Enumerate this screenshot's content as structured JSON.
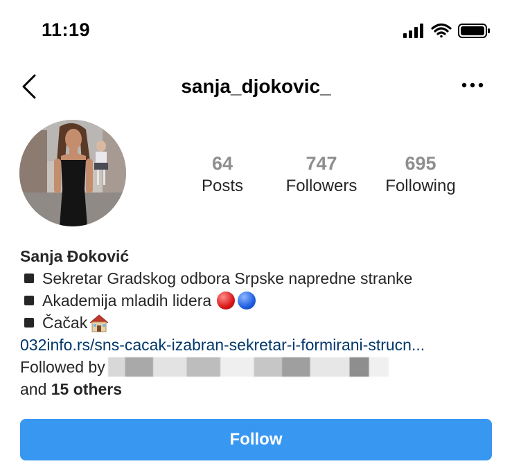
{
  "status_bar": {
    "time": "11:19",
    "icons": [
      "signal-bars-icon",
      "wifi-icon",
      "battery-icon"
    ]
  },
  "nav": {
    "title": "sanja_djokovic_",
    "back_icon": "chevron-left-icon",
    "more_icon": "more-horizontal-icon"
  },
  "profile": {
    "stats": [
      {
        "value": "64",
        "label": "Posts"
      },
      {
        "value": "747",
        "label": "Followers"
      },
      {
        "value": "695",
        "label": "Following"
      }
    ],
    "name": "Sanja Đoković",
    "bio_lines": [
      "Sekretar Gradskog odbora Srpske napredne stranke",
      "Akademija mladih lidera",
      "Čačak"
    ],
    "link": "032info.rs/sns-cacak-izabran-sekretar-i-formirani-strucn...",
    "followed_by_label": "Followed by",
    "and_label": "and",
    "others_label": "15 others"
  },
  "actions": {
    "follow_label": "Follow"
  },
  "colors": {
    "follow_button": "#3897f0",
    "link": "#00376b",
    "stat_number": "#8e8e8e",
    "text": "#262626"
  }
}
